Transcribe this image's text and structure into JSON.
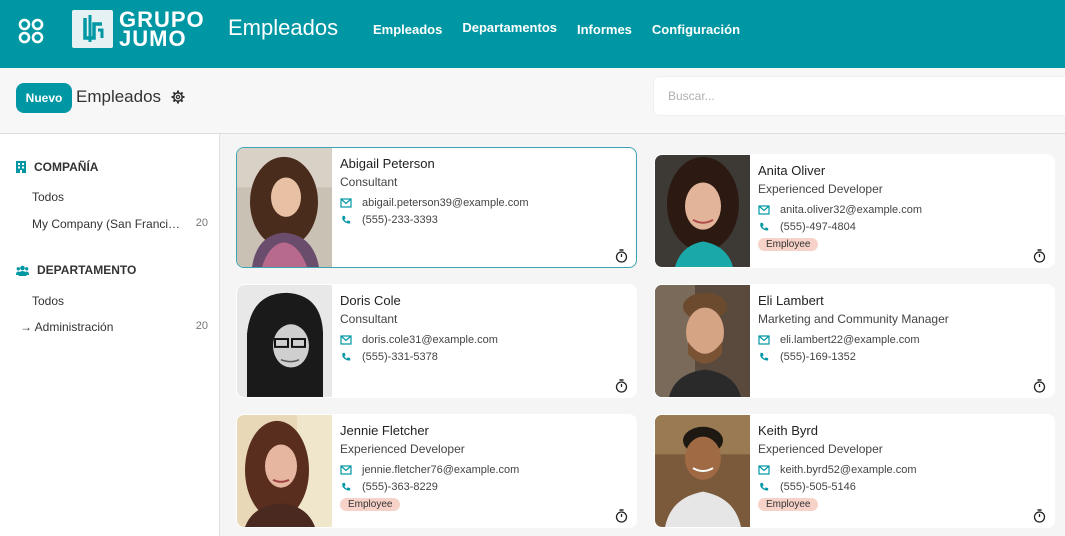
{
  "app": {
    "brand_line1": "GRUPO",
    "brand_line2": "JUMO",
    "title": "Empleados",
    "accent": "#0097a4"
  },
  "nav": [
    "Empleados",
    "Departamentos",
    "Informes",
    "Configuración"
  ],
  "control": {
    "new_label": "Nuevo",
    "breadcrumb": "Empleados",
    "search_placeholder": "Buscar..."
  },
  "sidebar": {
    "company": {
      "title": "COMPAÑÍA",
      "items": [
        {
          "label": "Todos",
          "count": ""
        },
        {
          "label": "My Company (San Francisco)",
          "count": "20"
        }
      ]
    },
    "department": {
      "title": "DEPARTAMENTO",
      "items": [
        {
          "label": "Todos",
          "count": ""
        },
        {
          "label": "→ Administración",
          "count": "20"
        }
      ]
    }
  },
  "employees": [
    {
      "name": "Abigail Peterson",
      "job": "Consultant",
      "email": "abigail.peterson39@example.com",
      "phone": "(555)-233-3393",
      "tag": ""
    },
    {
      "name": "Anita Oliver",
      "job": "Experienced Developer",
      "email": "anita.oliver32@example.com",
      "phone": "(555)-497-4804",
      "tag": "Employee"
    },
    {
      "name": "Doris Cole",
      "job": "Consultant",
      "email": "doris.cole31@example.com",
      "phone": "(555)-331-5378",
      "tag": ""
    },
    {
      "name": "Eli Lambert",
      "job": "Marketing and Community Manager",
      "email": "eli.lambert22@example.com",
      "phone": "(555)-169-1352",
      "tag": ""
    },
    {
      "name": "Jennie Fletcher",
      "job": "Experienced Developer",
      "email": "jennie.fletcher76@example.com",
      "phone": "(555)-363-8229",
      "tag": "Employee"
    },
    {
      "name": "Keith Byrd",
      "job": "Experienced Developer",
      "email": "keith.byrd52@example.com",
      "phone": "(555)-505-5146",
      "tag": "Employee"
    }
  ]
}
